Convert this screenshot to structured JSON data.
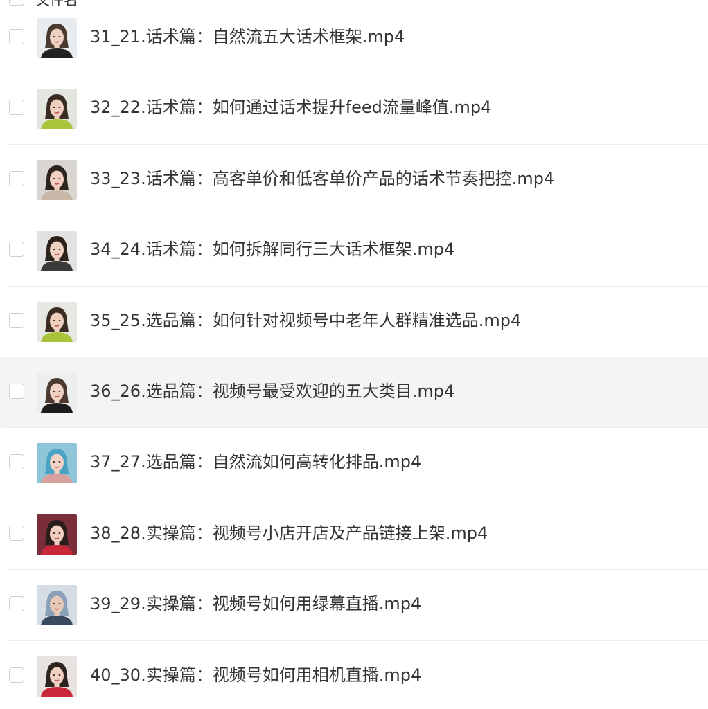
{
  "header": {
    "partial_label": "文件名"
  },
  "files": [
    {
      "name": "31_21.话术篇：自然流五大话术框架.mp4",
      "thumb": {
        "bg": "#e9ecef",
        "hair": "#4a3a30",
        "shirt": "#222222",
        "skin": "#f0d2c4"
      }
    },
    {
      "name": "32_22.话术篇：如何通过话术提升feed流量峰值.mp4",
      "thumb": {
        "bg": "#e3e6df",
        "hair": "#3a2c22",
        "shirt": "#a9c43a",
        "skin": "#efcfbd"
      }
    },
    {
      "name": "33_23.话术篇：高客单价和低客单价产品的话术节奏把控.mp4",
      "thumb": {
        "bg": "#d9d6d2",
        "hair": "#2e241e",
        "shirt": "#c9b8a8",
        "skin": "#f1d0c2"
      }
    },
    {
      "name": "34_24.话术篇：如何拆解同行三大话术框架.mp4",
      "thumb": {
        "bg": "#e2e2e2",
        "hair": "#2c221c",
        "shirt": "#3a3a3a",
        "skin": "#efd0c3"
      }
    },
    {
      "name": "35_25.选品篇：如何针对视频号中老年人群精准选品.mp4",
      "thumb": {
        "bg": "#e6e8e1",
        "hair": "#3a2c22",
        "shirt": "#a9c43a",
        "skin": "#efcfbd"
      }
    },
    {
      "name": "36_26.选品篇：视频号最受欢迎的五大类目.mp4",
      "thumb": {
        "bg": "#eceef0",
        "hair": "#4a3a30",
        "shirt": "#1d1d1d",
        "skin": "#f0d2c4"
      }
    },
    {
      "name": "37_27.选品篇：自然流如何高转化排品.mp4",
      "thumb": {
        "bg": "#8ec6d8",
        "hair": "#4aa3c4",
        "shirt": "#d9a0a0",
        "skin": "#f1d3c6"
      }
    },
    {
      "name": "38_28.实操篇：视频号小店开店及产品链接上架.mp4",
      "thumb": {
        "bg": "#7a2e3a",
        "hair": "#2a1e1a",
        "shirt": "#c8283a",
        "skin": "#f0cfc0"
      }
    },
    {
      "name": "39_29.实操篇：视频号如何用绿幕直播.mp4",
      "thumb": {
        "bg": "#d6dce4",
        "hair": "#8aa0b8",
        "shirt": "#3a4a5e",
        "skin": "#e8c8b8"
      }
    },
    {
      "name": "40_30.实操篇：视频号如何用相机直播.mp4",
      "thumb": {
        "bg": "#e8e3e0",
        "hair": "#2e241e",
        "shirt": "#c8283a",
        "skin": "#f0d0c2"
      }
    }
  ],
  "selected_index": 5
}
